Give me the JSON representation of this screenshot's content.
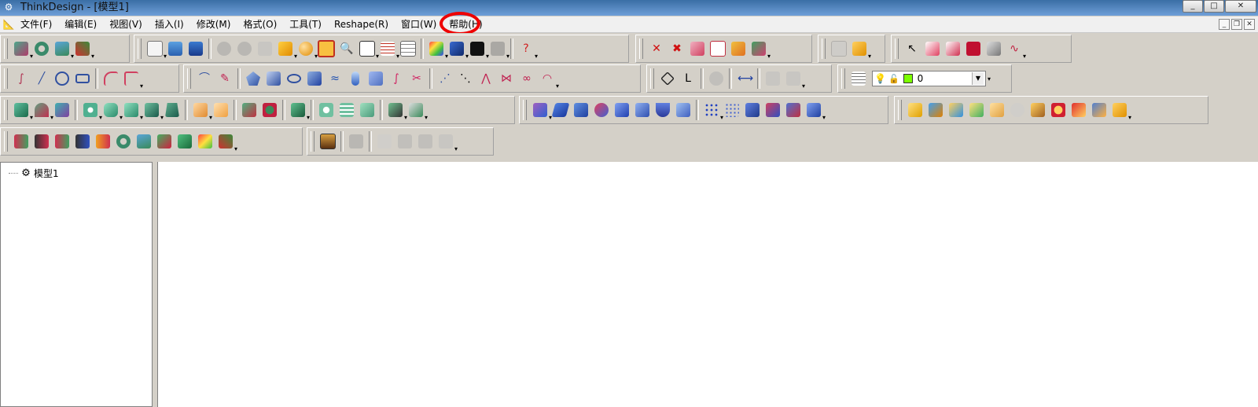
{
  "window": {
    "title": "ThinkDesign  - [模型1]",
    "controls": {
      "minimize": "_",
      "maximize": "□",
      "close": "✕"
    },
    "mdi_controls": {
      "minimize": "_",
      "restore": "❐",
      "close": "✕"
    }
  },
  "menubar": {
    "items": [
      {
        "label": "文件(F)"
      },
      {
        "label": "编辑(E)"
      },
      {
        "label": "视图(V)"
      },
      {
        "label": "插入(I)"
      },
      {
        "label": "修改(M)"
      },
      {
        "label": "格式(O)"
      },
      {
        "label": "工具(T)"
      },
      {
        "label": "Reshape(R)"
      },
      {
        "label": "窗口(W)"
      },
      {
        "label": "帮助(H)",
        "highlighted": true
      }
    ]
  },
  "layer_selector": {
    "value": "0",
    "color": "#7cff00"
  },
  "tree": {
    "root_label": "模型1"
  },
  "colors": {
    "highlight_circle": "#e00000",
    "accent_blue": "#3a6ea5"
  }
}
